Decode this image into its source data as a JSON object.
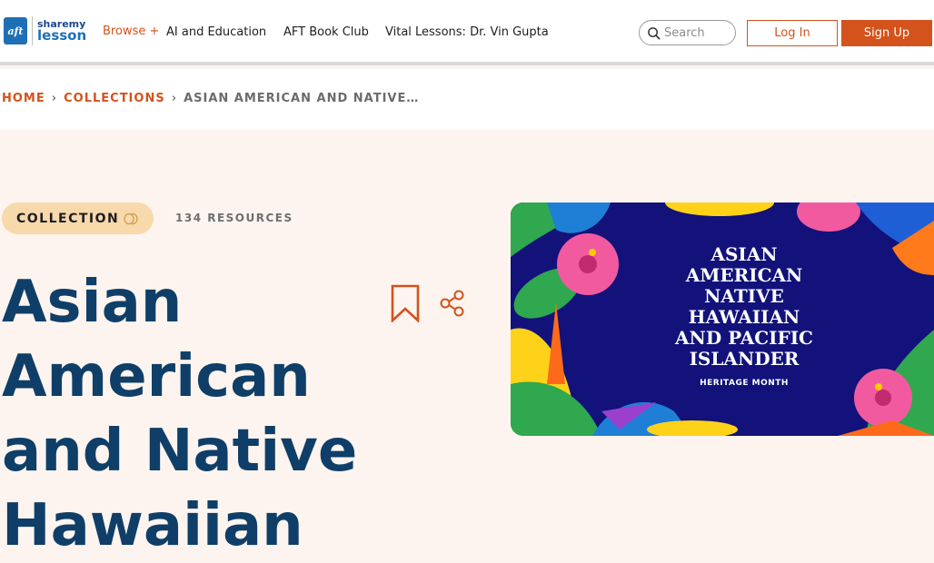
{
  "header": {
    "logo": {
      "line1": "sharemy",
      "line2": "lesson",
      "mark": "aft"
    },
    "browse_label": "Browse +",
    "nav": [
      "AI and Education",
      "AFT Book Club",
      "Vital Lessons: Dr. Vin Gupta"
    ],
    "search_placeholder": "Search",
    "login_label": "Log In",
    "signup_label": "Sign Up"
  },
  "breadcrumb": {
    "home": "HOME",
    "collections": "COLLECTIONS",
    "current": "ASIAN AMERICAN AND NATIVE…"
  },
  "hero": {
    "badge_label": "COLLECTION",
    "resource_count": "134 RESOURCES",
    "title": "Asian American and Native Hawaiian",
    "banner": {
      "lines": [
        "ASIAN",
        "AMERICAN",
        "NATIVE",
        "HAWAIIAN",
        "AND PACIFIC",
        "ISLANDER"
      ],
      "subline": "HERITAGE MONTH"
    }
  },
  "colors": {
    "accent": "#d4521b",
    "title": "#0f3f68",
    "hero_bg": "#fdf4ef",
    "badge_bg": "#f8d9ac",
    "banner_bg": "#12127a"
  },
  "icons": [
    "logo-mark",
    "search-icon",
    "coins-icon",
    "bookmark-icon",
    "share-icon"
  ]
}
